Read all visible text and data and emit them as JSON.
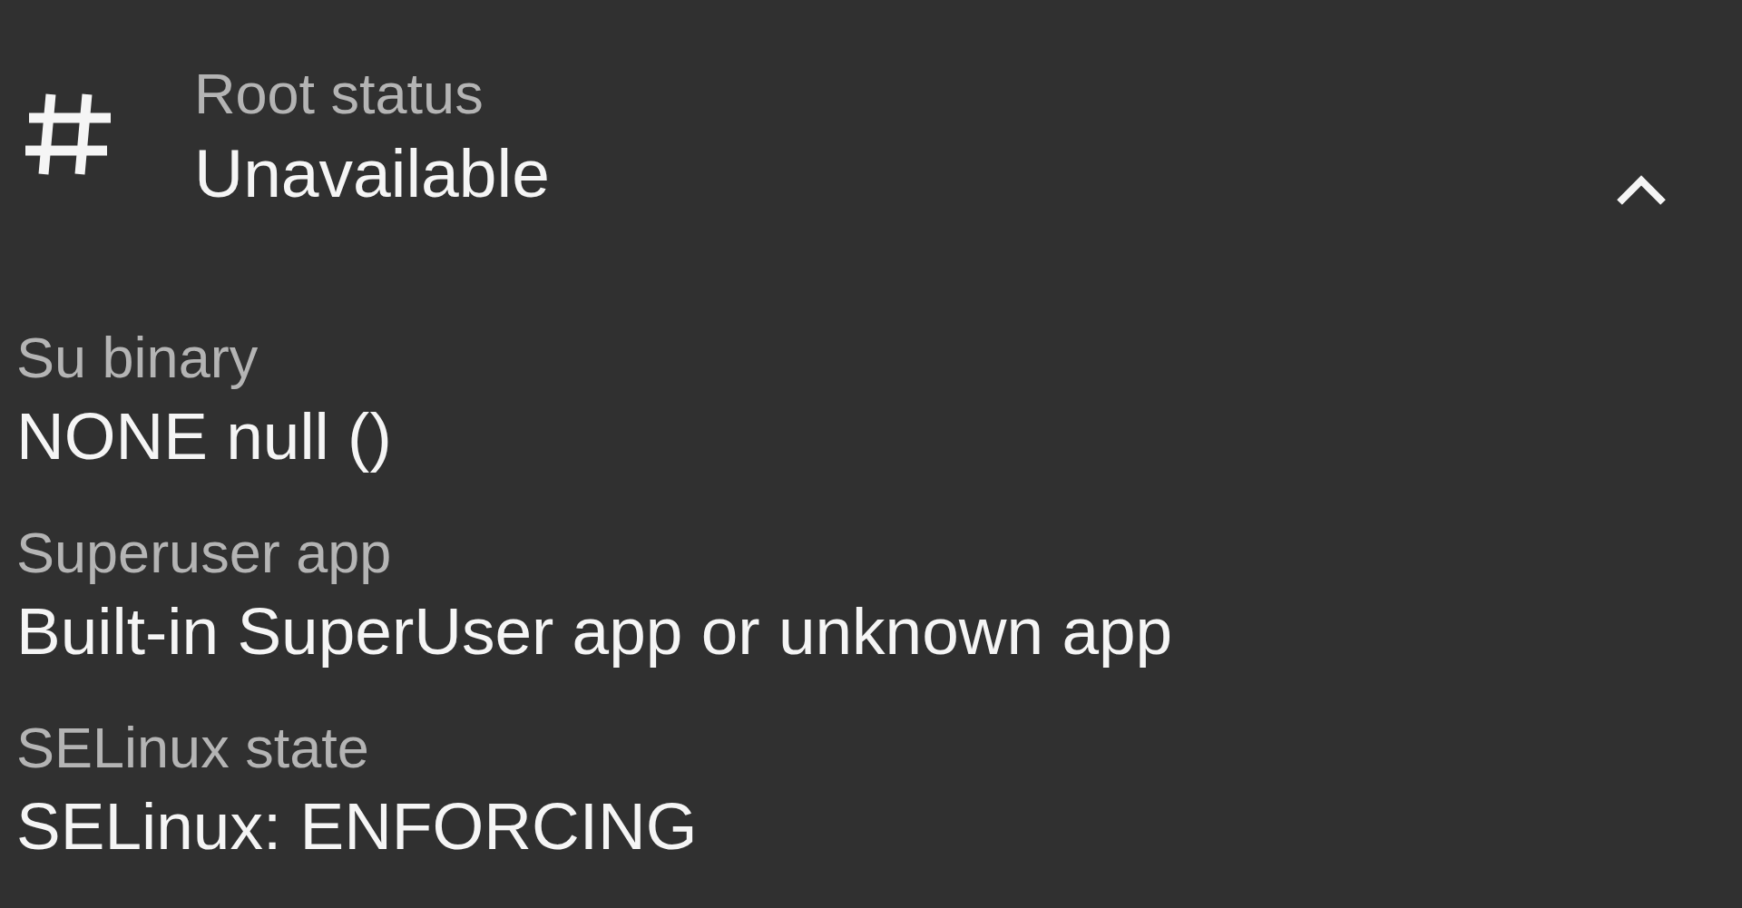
{
  "card": {
    "title": "Root status",
    "value": "Unavailable",
    "expanded": true,
    "details": [
      {
        "label": "Su binary",
        "value": "NONE null ()"
      },
      {
        "label": "Superuser app",
        "value": "Built-in SuperUser app or unknown app"
      },
      {
        "label": "SELinux state",
        "value": "SELinux: ENFORCING"
      }
    ]
  }
}
